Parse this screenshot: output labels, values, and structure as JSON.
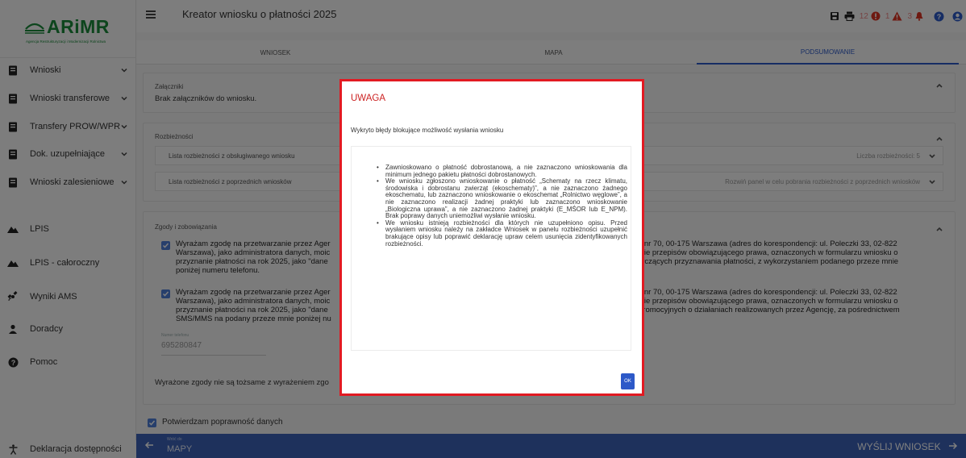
{
  "logo": {
    "brand": "ARiMR",
    "tagline": "Agencja Restrukturyzacji i Modernizacji Rolnictwa"
  },
  "sidebar": {
    "items": [
      {
        "label": "Wnioski",
        "icon": "document-icon",
        "has_chevron": true
      },
      {
        "label": "Wnioski transferowe",
        "icon": "document-icon",
        "has_chevron": true
      },
      {
        "label": "Transfery PROW/WPR",
        "icon": "document-icon",
        "has_chevron": true
      },
      {
        "label": "Dok. uzupełniające",
        "icon": "document-icon",
        "has_chevron": true
      },
      {
        "label": "Wnioski zalesieniowe",
        "icon": "document-icon",
        "has_chevron": true
      },
      {
        "label": "LPIS",
        "icon": "mountain-icon",
        "has_chevron": false
      },
      {
        "label": "LPIS - całoroczny",
        "icon": "mountain-icon",
        "has_chevron": false
      },
      {
        "label": "Wyniki AMS",
        "icon": "satellite-icon",
        "has_chevron": false
      },
      {
        "label": "Doradcy",
        "icon": "person-icon",
        "has_chevron": false
      },
      {
        "label": "Pomoc",
        "icon": "help-icon",
        "has_chevron": false
      }
    ],
    "footer_item": {
      "label": "Deklaracja dostępności",
      "icon": "accessibility-icon"
    }
  },
  "header": {
    "title": "Kreator wniosku o płatności 2025",
    "counts": {
      "errors": "12",
      "warnings": "1",
      "alerts": "3"
    }
  },
  "tabs": [
    {
      "label": "WNIOSEK",
      "active": false
    },
    {
      "label": "MAPA",
      "active": false
    },
    {
      "label": "PODSUMOWANIE",
      "active": true
    }
  ],
  "attachments": {
    "title": "Załączniki",
    "text": "Brak załączników do wniosku."
  },
  "discrepancies": {
    "title": "Rozbieżności",
    "rows": [
      {
        "label": "Lista rozbieżności z obsługiwanego wniosku",
        "right": "Liczba rozbieżności: 5"
      },
      {
        "label": "Lista rozbieżności z poprzednich wniosków",
        "right": "Rozwiń panel w celu pobrania rozbieżności z poprzednich wniosków"
      }
    ]
  },
  "consents": {
    "title": "Zgody i zobowiązania",
    "consent1_left": [
      "Wyrażam zgodę na przetwarzanie przez Ager",
      "Warszawa), jako administratora danych, moic",
      "przyznanie płatności na rok 2025, jako \"dane",
      "poniżej numeru telefonu."
    ],
    "consent1_right": [
      "ll nr 70, 00-175 Warszawa (adres do korespondencji: ul. Poleczki 33, 02-822",
      "wie przepisów obowiązującego prawa, oznaczonych w formularzu wniosku o",
      "tyczących przyznawania płatności, z wykorzystaniem podanego przeze mnie"
    ],
    "consent2_left": [
      "Wyrażam zgodę na przetwarzanie przez Ager",
      "Warszawa), jako administratora danych, moic",
      "przyznanie płatności na rok 2025, jako \"dane",
      "SMS/MMS na podany przeze mnie poniżej nu"
    ],
    "consent2_right": [
      "ll nr 70, 00-175 Warszawa (adres do korespondencji: ul. Poleczki 33, 02-822",
      "wie przepisów obowiązującego prawa, oznaczonych w formularzu wniosku o",
      "promocyjnych o działaniach realizowanych przez Agencję, za pośrednictwem"
    ],
    "phone_label": "Numer telefonu",
    "phone_value": "695280847",
    "note": "Wyrażone zgody nie są tożsame z wyrażeniem zgo"
  },
  "confirm": {
    "label": "Potwierdzam poprawność danych"
  },
  "footer": {
    "back_small": "Wróć do",
    "back_big": "MAPY",
    "send": "WYŚLIJ WNIOSEK"
  },
  "modal": {
    "title": "UWAGA",
    "message": "Wykryto błędy blokujące możliwość wysłania wniosku",
    "items": [
      "Zawnioskowano o płatność dobrostanową, a nie zaznaczono wnioskowania dla minimum jednego pakietu płatności dobrostanowych.",
      "We wniosku zgłoszono wnioskowanie o płatność „Schematy na rzecz klimatu, środowiska i dobrostanu zwierząt (ekoschematy)”, a nie zaznaczono żadnego ekoschematu, lub zaznaczono wnioskowanie o ekoschemat „Rolnictwo węglowe”, a nie zaznaczono realizacji żadnej praktyki lub zaznaczono wnioskowanie „Biologiczna uprawa”, a nie zaznaczono żadnej praktyki (E_MŚOR lub E_NPM). Brak poprawy danych uniemożliwi wysłanie wniosku.",
      "We wniosku istnieją rozbieżności dla których nie uzupełniono opisu. Przed wysłaniem wniosku należy na zakładce Wniosek w panelu rozbieżności uzupełnić brakujące opisy lub poprawić deklarację upraw celem usunięcia zidentyfikowanych rozbieżności."
    ],
    "ok_label": "OK"
  },
  "colors": {
    "accent": "#2d5ac8",
    "brand": "#1a8a3a",
    "danger": "#e21a22",
    "footer": "#3d63b8"
  }
}
